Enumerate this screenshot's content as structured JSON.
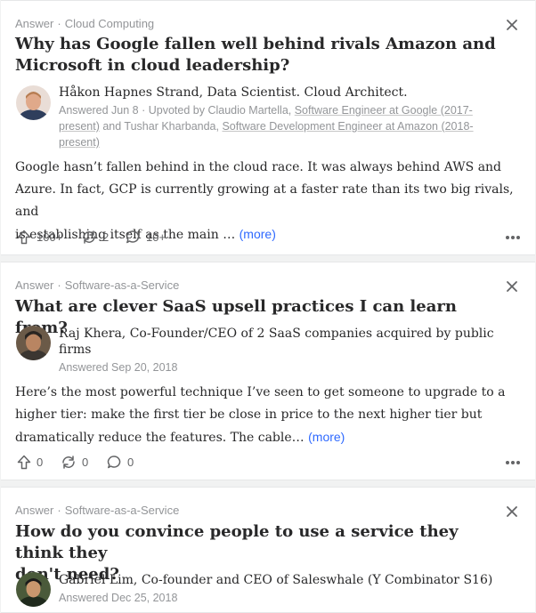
{
  "cards": [
    {
      "type": "Answer",
      "topic": "Cloud Computing",
      "question_line1": "Why has Google fallen well behind rivals Amazon and",
      "question_line2": "Microsoft in cloud leadership?",
      "author": "Håkon Hapnes Strand, Data Scientist. Cloud Architect.",
      "meta_line1_a": "Answered Jun 8 · Upvoted by Claudio Martella, ",
      "meta_line1_link": "Software Engineer at Google (2017-",
      "meta_line2_a": "present)",
      "meta_line2_b": " and Tushar Kharbanda, ",
      "meta_line2_link": "Software Development Engineer at Amazon (2018-",
      "meta_line3": "present)",
      "body_line1": "Google hasn’t fallen behind in the cloud race. It was always behind AWS and",
      "body_line2": "Azure. In fact, GCP is currently growing at a faster rate than its two big rivals, and",
      "body_line3": "is establishing itself as the main …",
      "more": "(more)",
      "upvotes": "100+",
      "shares": "2",
      "comments": "10+"
    },
    {
      "type": "Answer",
      "topic": "Software-as-a-Service",
      "question_line1": "What are clever SaaS upsell practices I can learn from?",
      "author_line1": "Raj Khera, Co-Founder/CEO of 2 SaaS companies acquired by public",
      "author_line2": "firms",
      "meta": "Answered Sep 20, 2018",
      "body_line1": "Here’s the most powerful technique I’ve seen to get someone to upgrade to a",
      "body_line2": "higher tier: make the first tier be close in price to the next higher tier but",
      "body_line3": "dramatically reduce the features. The cable…",
      "more": "(more)",
      "upvotes": "0",
      "shares": "0",
      "comments": "0"
    },
    {
      "type": "Answer",
      "topic": "Software-as-a-Service",
      "question_line1": "How do you convince people to use a service they think they",
      "question_line2": "don't need?",
      "author": "Gabriel Lim, Co-founder and CEO of Saleswhale (Y Combinator S16)",
      "meta": "Answered Dec 25, 2018"
    }
  ],
  "icons": {
    "close": "close-icon",
    "upvote": "upvote-arrow-icon",
    "share": "share-icon",
    "comment": "comment-icon",
    "overflow": "more-options-icon"
  },
  "colors": {
    "link": "#2e69ff",
    "muted": "#939598",
    "text": "#282829",
    "background": "#f1f2f2"
  }
}
